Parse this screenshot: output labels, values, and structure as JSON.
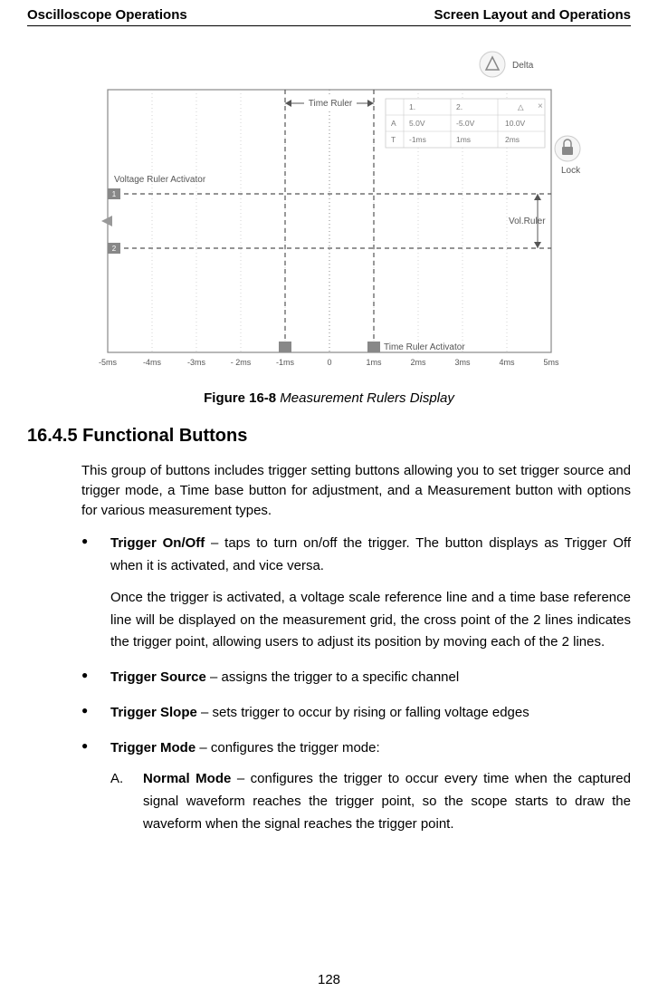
{
  "header": {
    "left": "Oscilloscope Operations",
    "right": "Screen Layout and Operations"
  },
  "figure": {
    "caption_label": "Figure 16-8",
    "caption_text": " Measurement Rulers Display",
    "time_ruler_label": "Time Ruler",
    "voltage_ruler_activator": "Voltage Ruler Activator",
    "vol_ruler": "Vol.Ruler",
    "time_ruler_activator": "Time Ruler Activator",
    "delta_label": "Delta",
    "lock_label": "Lock",
    "data_table": {
      "c1": "1.",
      "c2": "2.",
      "delta_sym": "△",
      "rA_label": "A",
      "rA_1": "5.0V",
      "rA_2": "-5.0V",
      "rA_d": "10.0V",
      "rT_label": "T",
      "rT_1": "-1ms",
      "rT_2": "1ms",
      "rT_d": "2ms"
    },
    "xticks": [
      "-5ms",
      "-4ms",
      "-3ms",
      "- 2ms",
      "-1ms",
      "0",
      "1ms",
      "2ms",
      "3ms",
      "4ms",
      "5ms"
    ]
  },
  "section_heading": "16.4.5 Functional Buttons",
  "intro": "This group of buttons includes trigger setting buttons allowing you to set trigger source and trigger mode, a Time base button for adjustment, and a Measurement button with options for various measurement types.",
  "b1": {
    "title": "Trigger On/Off",
    "text": " – taps to turn on/off the trigger. The button displays as Trigger Off when it is activated, and vice versa.",
    "follow": "Once the trigger is activated, a voltage scale reference line and a time base reference line will be displayed on the measurement grid, the cross point of the 2 lines indicates the trigger point, allowing users to adjust its position by moving each of the 2 lines."
  },
  "b2": {
    "title": "Trigger Source",
    "text": " – assigns the trigger to a specific channel"
  },
  "b3": {
    "title": "Trigger Slope",
    "text": " – sets trigger to occur by rising or falling voltage edges"
  },
  "b4": {
    "title": "Trigger Mode",
    "text": " – configures the trigger mode:",
    "A_letter": "A.",
    "A_title": "Normal Mode",
    "A_text": " – configures the trigger to occur every time when the captured signal waveform reaches the trigger point, so the scope starts to draw the waveform when the signal reaches the trigger point."
  },
  "page_num": "128"
}
